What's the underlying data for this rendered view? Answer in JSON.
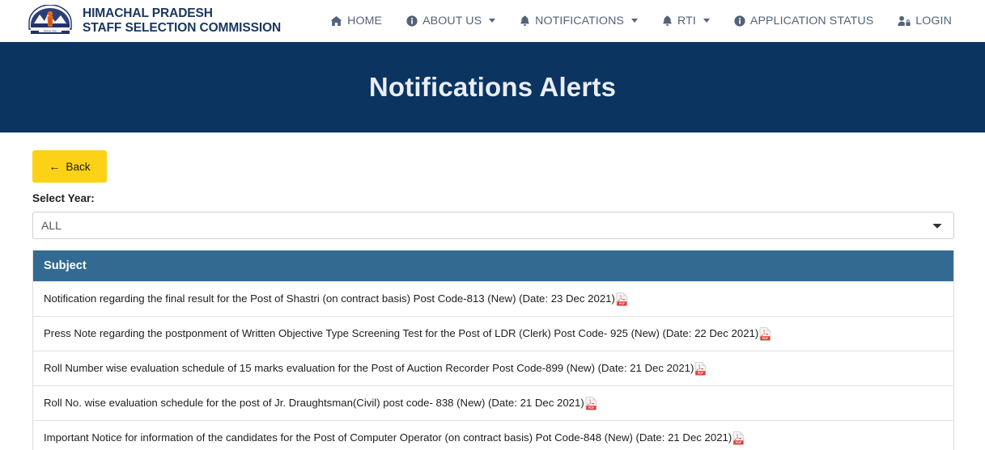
{
  "header": {
    "logo_icon": "hpssc-emblem-logo",
    "brand_line1": "HIMACHAL PRADESH",
    "brand_line2": "STAFF SELECTION COMMISSION",
    "nav": [
      {
        "label": "HOME",
        "icon": "home-icon",
        "caret": false
      },
      {
        "label": "ABOUT US",
        "icon": "info-circle-icon",
        "caret": true
      },
      {
        "label": "NOTIFICATIONS",
        "icon": "bell-icon",
        "caret": true
      },
      {
        "label": "RTI",
        "icon": "bell-icon",
        "caret": true
      },
      {
        "label": "APPLICATION STATUS",
        "icon": "info-circle-icon",
        "caret": false
      },
      {
        "label": "LOGIN",
        "icon": "user-lock-icon",
        "caret": false
      }
    ]
  },
  "banner": {
    "title": "Notifications Alerts",
    "background_color": "#0b3460"
  },
  "toolbar": {
    "back_label": "Back",
    "back_icon": "arrow-left-icon",
    "back_color": "#fcd116",
    "year_label": "Select Year:",
    "year_selected": "ALL",
    "year_options": [
      "ALL"
    ]
  },
  "table": {
    "header_color": "#336a92",
    "columns": [
      "Subject"
    ],
    "rows": [
      {
        "subject": "Notification regarding the final result for the Post of Shastri (on contract basis) Post Code-813 (New) (Date: 23 Dec 2021)",
        "attachment": "pdf-icon"
      },
      {
        "subject": "Press Note regarding the postponment of Written Objective Type Screening Test for the Post of LDR (Clerk) Post Code- 925 (New) (Date: 22 Dec 2021)",
        "attachment": "pdf-icon"
      },
      {
        "subject": "Roll Number wise evaluation schedule of 15 marks evaluation for the Post of Auction Recorder Post Code-899 (New) (Date: 21 Dec 2021)",
        "attachment": "pdf-icon"
      },
      {
        "subject": "Roll No. wise evaluation schedule for the post of Jr. Draughtsman(Civil) post code- 838 (New) (Date: 21 Dec 2021)",
        "attachment": "pdf-icon"
      },
      {
        "subject": "Important Notice for information of the candidates for the Post of Computer Operator (on contract basis) Pot Code-848 (New) (Date: 21 Dec 2021)",
        "attachment": "pdf-icon"
      }
    ]
  }
}
